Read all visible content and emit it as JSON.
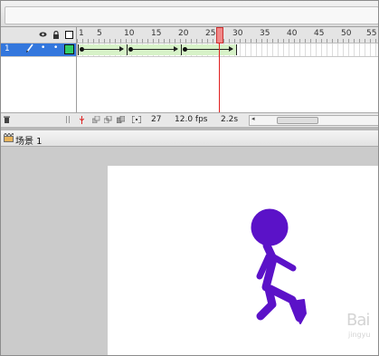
{
  "timeline": {
    "ruler_labels": [
      "1",
      "5",
      "10",
      "15",
      "20",
      "25",
      "30",
      "35",
      "40",
      "45",
      "50",
      "55"
    ],
    "layer": {
      "number": "1"
    },
    "status": {
      "frame": "27",
      "fps": "12.0 fps",
      "time": "2.2s"
    }
  },
  "scene": {
    "label": "场景 1"
  },
  "watermark": {
    "text": "Bai",
    "sub": "jingyu"
  },
  "colors": {
    "figure": "#5b12c8",
    "tween": "#d7f2c8",
    "playhead": "#e02020",
    "layer_selected": "#3377dd"
  }
}
